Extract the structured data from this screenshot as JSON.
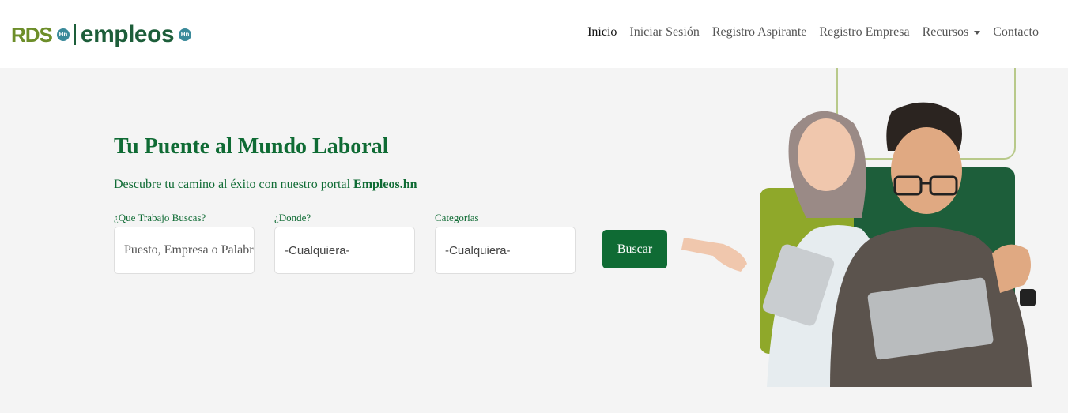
{
  "brand": {
    "rds": "RDS",
    "rds_badge": "Hn",
    "empleos": "empleos",
    "empleos_badge": "Hn"
  },
  "nav": {
    "items": [
      "Inicio",
      "Iniciar Sesión",
      "Registro Aspirante",
      "Registro Empresa",
      "Recursos",
      "Contacto"
    ]
  },
  "hero": {
    "title": "Tu Puente al Mundo Laboral",
    "subtitle_prefix": "Descubre tu camino al éxito con nuestro portal",
    "subtitle_brand": "Empleos.hn"
  },
  "search": {
    "job_label": "¿Que Trabajo Buscas?",
    "job_placeholder": "Puesto, Empresa o Palabra clave",
    "location_label": "¿Donde?",
    "location_value": "-Cualquiera-",
    "category_label": "Categorías",
    "category_value": "-Cualquiera-",
    "submit_label": "Buscar"
  },
  "colors": {
    "primary": "#0f6b34",
    "accent_green": "#8fb82a",
    "dark_green": "#1d5e3a"
  }
}
